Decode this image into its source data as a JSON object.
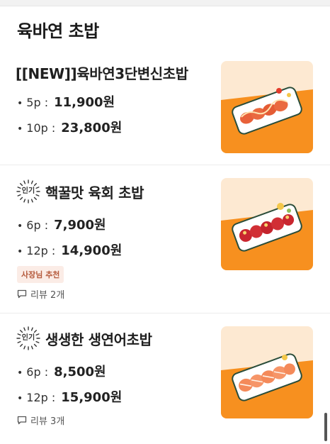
{
  "section": {
    "title": "육바연 초밥"
  },
  "items": [
    {
      "name": "[[NEW]]육바연3단변신초밥",
      "popular": false,
      "prices": [
        {
          "portion": "5p :",
          "amount": "11,900원"
        },
        {
          "portion": "10p :",
          "amount": "23,800원"
        }
      ],
      "image": "salmon-sushi-platter"
    },
    {
      "name": "핵꿀맛 육회 초밥",
      "popular": true,
      "badge": "인기",
      "prices": [
        {
          "portion": "6p :",
          "amount": "7,900원"
        },
        {
          "portion": "12p :",
          "amount": "14,900원"
        }
      ],
      "tag": "사장님 추천",
      "review": "리뷰 2개",
      "image": "beef-tartare-sushi-platter"
    },
    {
      "name": "생생한 생연어초밥",
      "popular": true,
      "badge": "인기",
      "prices": [
        {
          "portion": "6p :",
          "amount": "8,500원"
        },
        {
          "portion": "12p :",
          "amount": "15,900원"
        }
      ],
      "review": "리뷰 3개",
      "image": "raw-salmon-sushi-platter"
    }
  ],
  "colors": {
    "orange": "#f78a1e",
    "cream": "#fde9d2",
    "tag_bg": "#fbece6",
    "tag_text": "#b55a3c"
  }
}
